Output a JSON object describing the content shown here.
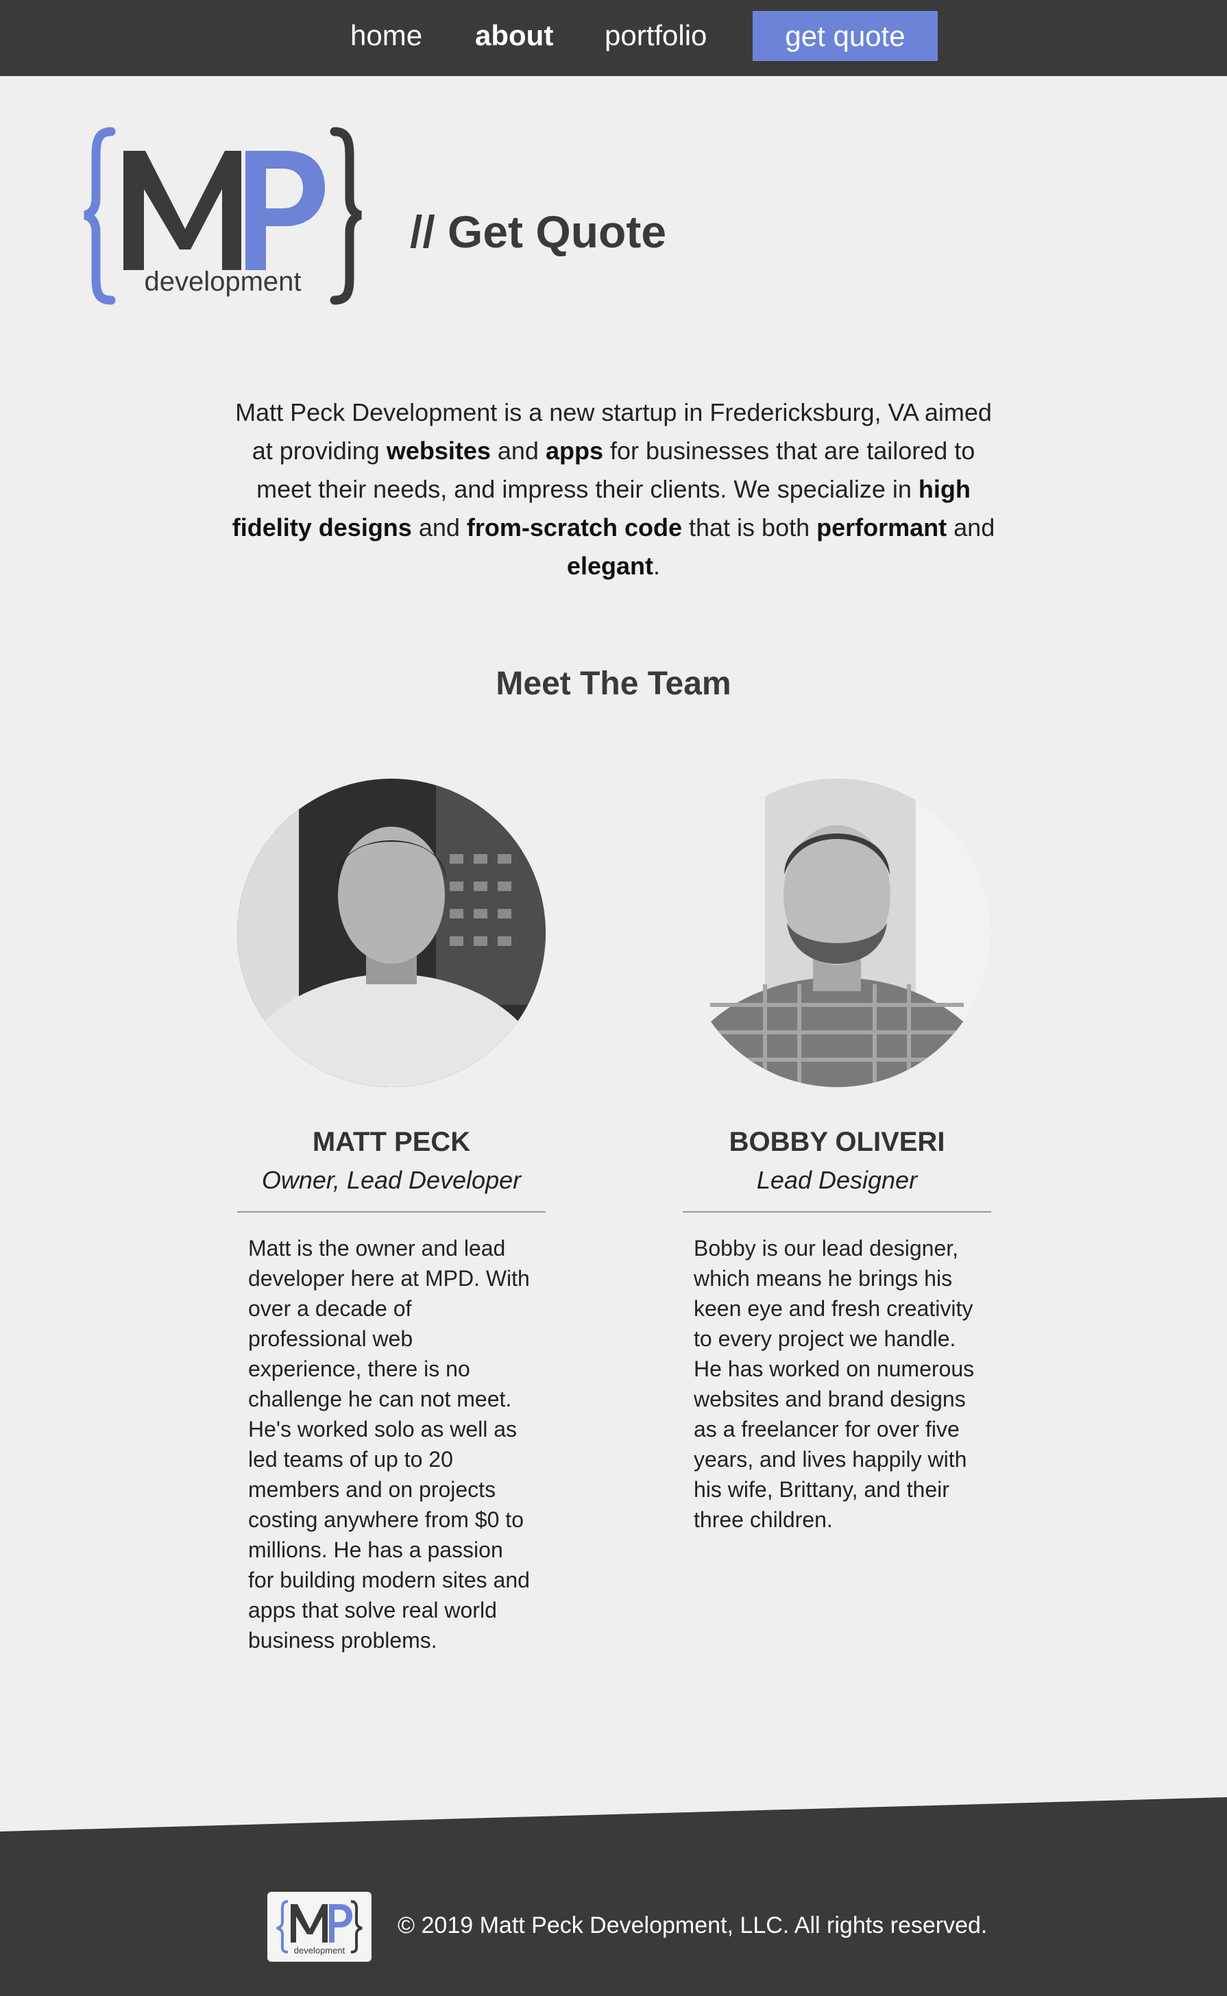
{
  "nav": {
    "home": "home",
    "about": "about",
    "portfolio": "portfolio",
    "cta": "get quote"
  },
  "brand": {
    "logo_letters": "MP",
    "logo_word": "development",
    "accent_color": "#6c83d8",
    "dark_color": "#3a3a3a"
  },
  "hero": {
    "heading": "// Get Quote"
  },
  "intro": {
    "p1": "Matt Peck Development is a new startup in Fredericksburg, VA aimed at providing ",
    "b1": "websites",
    "p2": " and ",
    "b2": "apps",
    "p3": " for businesses that are tailored to meet their needs, and impress their clients. We specialize in ",
    "b3": "high fidelity designs",
    "p4": " and ",
    "b4": "from-scratch code",
    "p5": " that is both ",
    "b5": "performant",
    "p6": " and ",
    "b6": "elegant",
    "p7": "."
  },
  "team": {
    "heading": "Meet The Team",
    "members": [
      {
        "name": "MATT PECK",
        "role": "Owner, Lead Developer",
        "bio": "Matt is the owner and lead developer here at MPD. With over a decade of professional web experience, there is no challenge he can not meet. He's worked solo as well as led teams of up to 20 members and on projects costing anywhere from $0 to millions. He has a passion for building modern sites and apps that solve real world business problems."
      },
      {
        "name": "BOBBY OLIVERI",
        "role": "Lead Designer",
        "bio": "Bobby is our lead designer, which means he brings his keen eye and fresh creativity to every project we handle. He has worked on numerous websites and brand designs as a freelancer for over five years, and lives happily with his wife, Brittany, and their three children."
      }
    ]
  },
  "footer": {
    "copyright": "© 2019 Matt Peck Development, LLC. All rights reserved."
  }
}
